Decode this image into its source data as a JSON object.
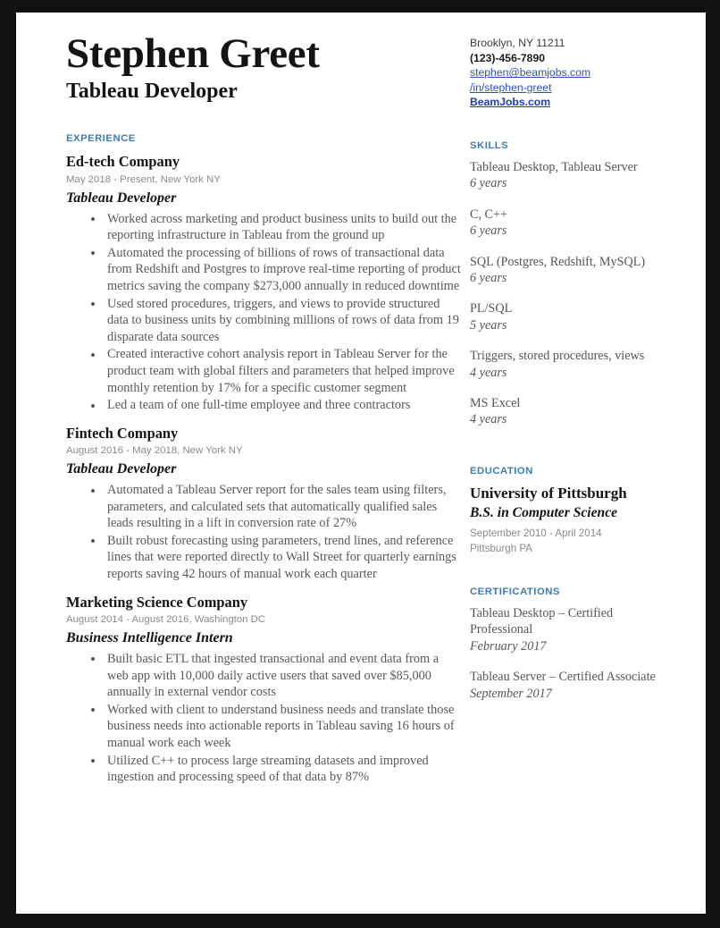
{
  "header": {
    "name": "Stephen Greet",
    "title": "Tableau Developer"
  },
  "contact": {
    "location": "Brooklyn, NY 11211",
    "phone": "(123)-456-7890",
    "email": "stephen@beamjobs.com",
    "linkedin": "/in/stephen-greet",
    "website": "BeamJobs.com"
  },
  "sections": {
    "experience": "EXPERIENCE",
    "skills": "SKILLS",
    "education": "EDUCATION",
    "certifications": "CERTIFICATIONS"
  },
  "experience": [
    {
      "company": "Ed-tech Company",
      "meta": "May 2018 - Present, New York NY",
      "role": "Tableau Developer",
      "bullets": [
        "Worked across marketing and product business units to build out the reporting infrastructure in Tableau from the ground up",
        "Automated the processing of billions of rows of transactional data from Redshift and Postgres to improve real-time reporting of product metrics saving the company $273,000 annually in reduced downtime",
        "Used stored procedures, triggers, and views to provide structured data to business units by combining millions of rows of data from 19 disparate data sources",
        "Created interactive cohort analysis report in Tableau Server for the product team with global filters and parameters that helped improve monthly retention by 17% for a specific customer segment",
        "Led a team of one full-time employee and three contractors"
      ]
    },
    {
      "company": "Fintech Company",
      "meta": "August 2016 - May 2018, New York NY",
      "role": "Tableau Developer",
      "bullets": [
        "Automated a Tableau Server report for the sales team using filters, parameters, and calculated sets that automatically qualified sales leads resulting in a lift in conversion rate of 27%",
        "Built robust forecasting using parameters, trend lines, and reference lines that were reported directly to Wall Street for quarterly earnings reports saving 42 hours of manual work each quarter"
      ]
    },
    {
      "company": "Marketing Science Company",
      "meta": "August 2014 - August 2016, Washington DC",
      "role": "Business Intelligence Intern",
      "bullets": [
        "Built basic ETL that ingested transactional and event data from a web app with 10,000 daily active users that saved over $85,000 annually in external vendor costs",
        "Worked with client to understand business needs and translate those business needs into actionable reports in Tableau saving 16 hours of manual work each week",
        "Utilized C++ to process large streaming datasets and improved ingestion and processing speed of that data by 87%"
      ]
    }
  ],
  "skills": [
    {
      "name": "Tableau Desktop, Tableau Server",
      "years": "6 years"
    },
    {
      "name": "C, C++",
      "years": "6 years"
    },
    {
      "name": "SQL (Postgres, Redshift, MySQL)",
      "years": "6 years"
    },
    {
      "name": "PL/SQL",
      "years": "5 years"
    },
    {
      "name": "Triggers, stored procedures, views",
      "years": "4 years"
    },
    {
      "name": "MS Excel",
      "years": "4 years"
    }
  ],
  "education": {
    "school": "University of Pittsburgh",
    "degree": "B.S. in Computer Science",
    "dates": "September 2010 - April 2014",
    "location": "Pittsburgh PA"
  },
  "certifications": [
    {
      "name": "Tableau Desktop – Certified Professional",
      "date": "February 2017"
    },
    {
      "name": "Tableau Server – Certified Associate",
      "date": "September 2017"
    }
  ],
  "colors": {
    "accent": "#3c7cb4",
    "link": "#2b4fbf",
    "body": "#58585a",
    "heading": "#141414",
    "meta": "#8a8a8a"
  }
}
